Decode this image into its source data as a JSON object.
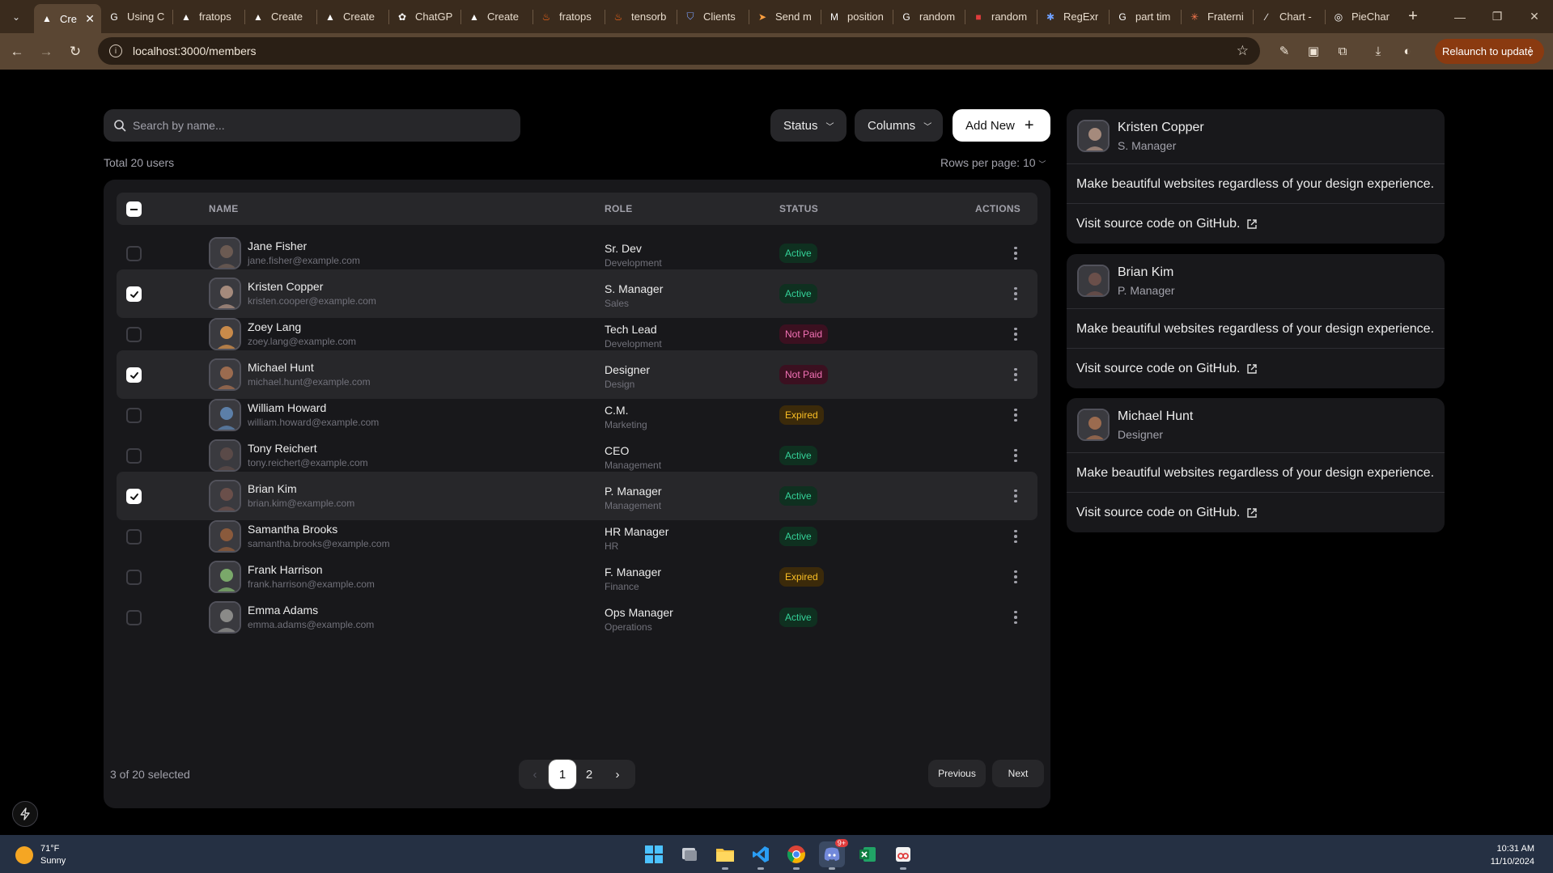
{
  "browser": {
    "tabs": [
      {
        "label": "Cre",
        "icon": "triangle-icon",
        "active": true
      },
      {
        "label": "Using C",
        "icon": "google-icon"
      },
      {
        "label": "fratops",
        "icon": "triangle-icon"
      },
      {
        "label": "Create",
        "icon": "triangle-icon"
      },
      {
        "label": "Create",
        "icon": "triangle-icon"
      },
      {
        "label": "ChatGP",
        "icon": "chatgpt-icon"
      },
      {
        "label": "Create",
        "icon": "triangle-icon"
      },
      {
        "label": "fratops",
        "icon": "flame-icon"
      },
      {
        "label": "tensorb",
        "icon": "flame-icon"
      },
      {
        "label": "Clients",
        "icon": "shield-icon"
      },
      {
        "label": "Send m",
        "icon": "send-icon"
      },
      {
        "label": "position",
        "icon": "m-icon"
      },
      {
        "label": "random",
        "icon": "google-icon"
      },
      {
        "label": "random",
        "icon": "red-square-icon"
      },
      {
        "label": "RegExr",
        "icon": "regex-icon"
      },
      {
        "label": "part tim",
        "icon": "google-icon"
      },
      {
        "label": "Fraterni",
        "icon": "asterisk-icon"
      },
      {
        "label": "Chart -",
        "icon": "slash-icon"
      },
      {
        "label": "PieChar",
        "icon": "globe-icon"
      }
    ],
    "url": "localhost:3000/members",
    "relaunch_label": "Relaunch to update"
  },
  "toolbar": {
    "search_placeholder": "Search by name...",
    "status_label": "Status",
    "columns_label": "Columns",
    "add_label": "Add New"
  },
  "summary": {
    "total_label": "Total 20 users",
    "rows_per_page_label": "Rows per page:",
    "rows_per_page_value": "10"
  },
  "table": {
    "columns": [
      "NAME",
      "ROLE",
      "STATUS",
      "ACTIONS"
    ],
    "rows": [
      {
        "name": "Jane Fisher",
        "email": "jane.fisher@example.com",
        "role": "Sr. Dev",
        "dept": "Development",
        "status": "Active",
        "selected": false,
        "avatar_color": "#6b5a52"
      },
      {
        "name": "Kristen Copper",
        "email": "kristen.cooper@example.com",
        "role": "S. Manager",
        "dept": "Sales",
        "status": "Active",
        "selected": true,
        "avatar_color": "#a58a7c"
      },
      {
        "name": "Zoey Lang",
        "email": "zoey.lang@example.com",
        "role": "Tech Lead",
        "dept": "Development",
        "status": "Not Paid",
        "selected": false,
        "avatar_color": "#c88a4a"
      },
      {
        "name": "Michael Hunt",
        "email": "michael.hunt@example.com",
        "role": "Designer",
        "dept": "Design",
        "status": "Not Paid",
        "selected": true,
        "avatar_color": "#9b6b4f"
      },
      {
        "name": "William Howard",
        "email": "william.howard@example.com",
        "role": "C.M.",
        "dept": "Marketing",
        "status": "Expired",
        "selected": false,
        "avatar_color": "#5c7fa8"
      },
      {
        "name": "Tony Reichert",
        "email": "tony.reichert@example.com",
        "role": "CEO",
        "dept": "Management",
        "status": "Active",
        "selected": false,
        "avatar_color": "#5a4a48"
      },
      {
        "name": "Brian Kim",
        "email": "brian.kim@example.com",
        "role": "P. Manager",
        "dept": "Management",
        "status": "Active",
        "selected": true,
        "avatar_color": "#6a4f4a"
      },
      {
        "name": "Samantha Brooks",
        "email": "samantha.brooks@example.com",
        "role": "HR Manager",
        "dept": "HR",
        "status": "Active",
        "selected": false,
        "avatar_color": "#8a5a3c"
      },
      {
        "name": "Frank Harrison",
        "email": "frank.harrison@example.com",
        "role": "F. Manager",
        "dept": "Finance",
        "status": "Expired",
        "selected": false,
        "avatar_color": "#7aa86a"
      },
      {
        "name": "Emma Adams",
        "email": "emma.adams@example.com",
        "role": "Ops Manager",
        "dept": "Operations",
        "status": "Active",
        "selected": false,
        "avatar_color": "#8a8a88"
      }
    ]
  },
  "footer": {
    "selected_label": "3 of 20 selected",
    "pages": [
      "1",
      "2"
    ],
    "current_page": "1",
    "prev_label": "Previous",
    "next_label": "Next"
  },
  "cards": [
    {
      "name": "Kristen Copper",
      "role": "S. Manager",
      "body": "Make beautiful websites regardless of your design experience.",
      "link": "Visit source code on GitHub.",
      "avatar_color": "#a58a7c"
    },
    {
      "name": "Brian Kim",
      "role": "P. Manager",
      "body": "Make beautiful websites regardless of your design experience.",
      "link": "Visit source code on GitHub.",
      "avatar_color": "#6a4f4a"
    },
    {
      "name": "Michael Hunt",
      "role": "Designer",
      "body": "Make beautiful websites regardless of your design experience.",
      "link": "Visit source code on GitHub.",
      "avatar_color": "#9b6b4f"
    }
  ],
  "taskbar": {
    "temperature": "71°F",
    "condition": "Sunny",
    "time": "10:31 AM",
    "date": "11/10/2024",
    "notification_badge": "9+"
  },
  "colors": {
    "active": "#34d399",
    "not_paid": "#f472b6",
    "expired": "#fbbf24"
  }
}
